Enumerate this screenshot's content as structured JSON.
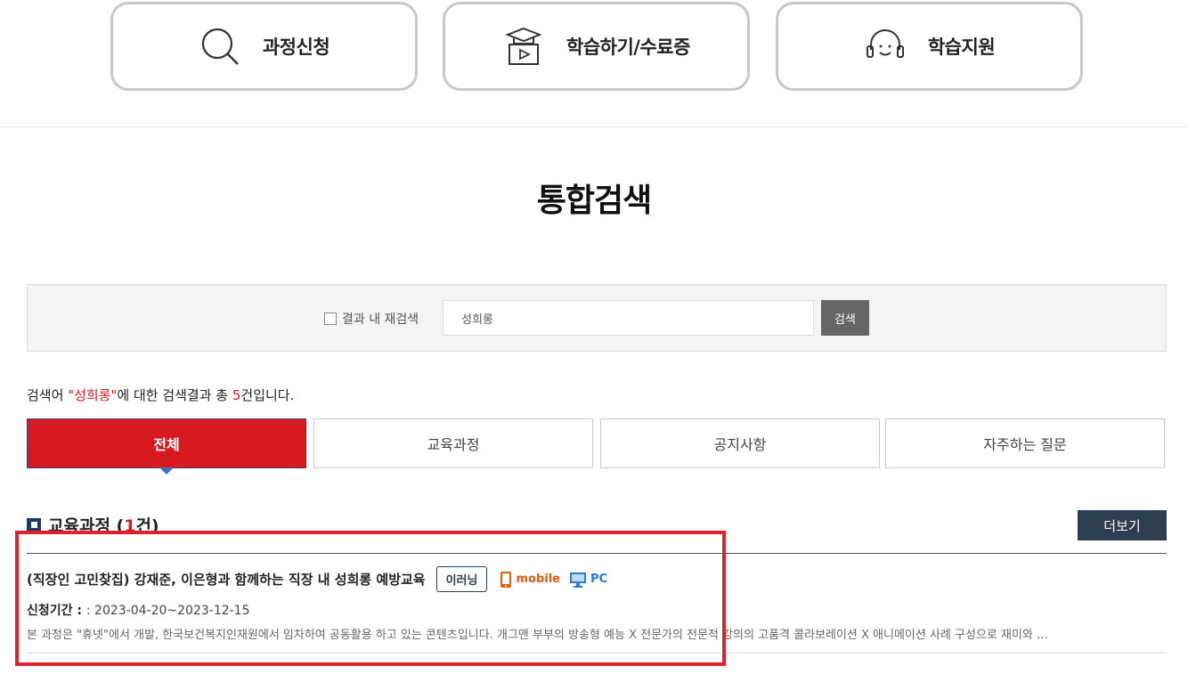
{
  "quick_menu": [
    {
      "label": "과정신청",
      "icon": "search-icon"
    },
    {
      "label": "학습하기/수료증",
      "icon": "graduation-video-icon"
    },
    {
      "label": "학습지원",
      "icon": "headset-icon"
    }
  ],
  "page_title": "통합검색",
  "search": {
    "re_search_label": "결과 내 재검색",
    "query": "성희롱",
    "button_label": "검색"
  },
  "summary": {
    "prefix": "검색어 ",
    "keyword": "\"성희롱\"",
    "middle": "에 대한 검색결과 총 ",
    "count": "5",
    "suffix": "건입니다."
  },
  "tabs": [
    {
      "label": "전체",
      "active": true
    },
    {
      "label": "교육과정"
    },
    {
      "label": "공지사항"
    },
    {
      "label": "자주하는 질문"
    }
  ],
  "section": {
    "title": "교육과정 (",
    "count": "1",
    "suffix": "건)",
    "more_label": "더보기"
  },
  "course": {
    "title": "(직장인 고민찾집) 강재준, 이은형과 함께하는 직장 내 성희롱 예방교육",
    "type_badge": "이러닝",
    "mobile_label": "mobile",
    "pc_label": "PC",
    "period_label": "신청기간 : ",
    "period_value": ": 2023-04-20~2023-12-15",
    "description": "본 과정은 \"휴넷\"에서 개발, 한국보건복지인재원에서 임차하여 공동활용 하고 있는 콘텐츠입니다. 개그맨 부부의 방송형 예능 X 전문가의 전문적 강의의 고품격 콜라보레이션 X 애니메이션 사례 구성으로 재미와 …"
  },
  "colors": {
    "accent": "#d71920",
    "navy": "#2d3e50",
    "highlight": "#e0202a"
  }
}
